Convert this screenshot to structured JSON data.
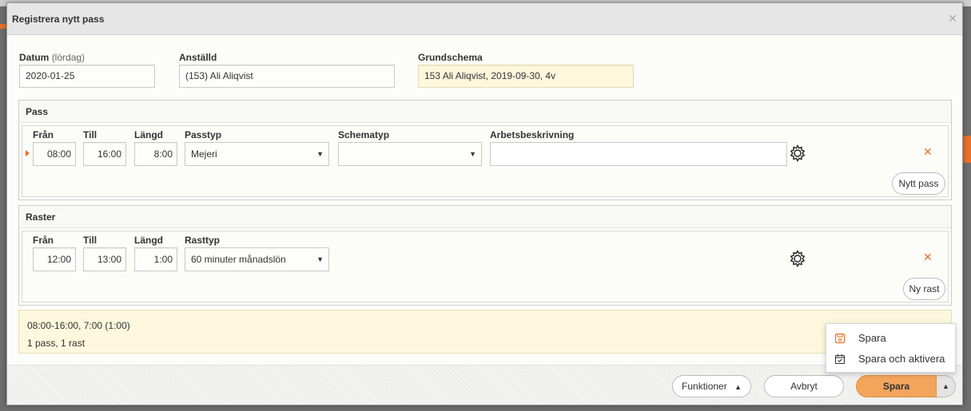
{
  "dialog": {
    "title": "Registrera nytt pass"
  },
  "header": {
    "date_label": "Datum",
    "date_sublabel": "(lördag)",
    "date_value": "2020-01-25",
    "employee_label": "Anställd",
    "employee_value": "(153) Ali Aliqvist",
    "schedule_label": "Grundschema",
    "schedule_value": "153 Ali Aliqvist, 2019-09-30, 4v"
  },
  "pass": {
    "section_title": "Pass",
    "col_from": "Från",
    "col_to": "Till",
    "col_length": "Längd",
    "col_type": "Passtyp",
    "col_schema": "Schematyp",
    "col_desc": "Arbetsbeskrivning",
    "from": "08:00",
    "to": "16:00",
    "length": "8:00",
    "type": "Mejeri",
    "schema": "",
    "desc": "",
    "new_button": "Nytt pass"
  },
  "raster": {
    "section_title": "Raster",
    "col_from": "Från",
    "col_to": "Till",
    "col_length": "Längd",
    "col_type": "Rasttyp",
    "from": "12:00",
    "to": "13:00",
    "length": "1:00",
    "type": "60 minuter månadslön",
    "new_button": "Ny rast"
  },
  "summary": {
    "line1": "08:00-16:00, 7:00 (1:00)",
    "line2": "1 pass, 1 rast"
  },
  "footer": {
    "functions_label": "Funktioner",
    "cancel_label": "Avbryt",
    "save_label": "Spara"
  },
  "save_menu": {
    "items": [
      {
        "label": "Spara",
        "icon": "save-icon"
      },
      {
        "label": "Spara och aktivera",
        "icon": "calendar-check-icon"
      }
    ]
  },
  "colors": {
    "accent": "#e8702a",
    "primary_button": "#f4a55c",
    "summary_bg": "#fcf7dd"
  }
}
